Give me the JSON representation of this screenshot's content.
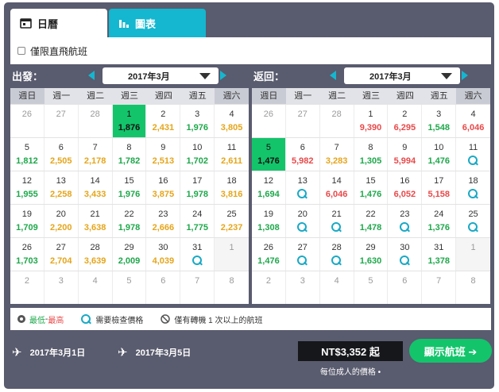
{
  "tabs": {
    "calendar": "日曆",
    "chart": "圖表"
  },
  "filter": {
    "direct_only": "僅限直飛航班"
  },
  "depart": {
    "label": "出發：",
    "month": "2017年3月",
    "dow": [
      "週日",
      "週一",
      "週二",
      "週三",
      "週四",
      "週五",
      "週六"
    ],
    "weeks": [
      [
        {
          "d": "26",
          "o": true
        },
        {
          "d": "27",
          "o": true
        },
        {
          "d": "28",
          "o": true
        },
        {
          "d": "1",
          "p": "1,876",
          "c": "low",
          "sel": true
        },
        {
          "d": "2",
          "p": "2,431",
          "c": "mid"
        },
        {
          "d": "3",
          "p": "1,976",
          "c": "low"
        },
        {
          "d": "4",
          "p": "3,805",
          "c": "mid"
        }
      ],
      [
        {
          "d": "5",
          "p": "1,812",
          "c": "low"
        },
        {
          "d": "6",
          "p": "2,505",
          "c": "mid"
        },
        {
          "d": "7",
          "p": "2,178",
          "c": "mid"
        },
        {
          "d": "8",
          "p": "1,782",
          "c": "low"
        },
        {
          "d": "9",
          "p": "2,513",
          "c": "mid"
        },
        {
          "d": "10",
          "p": "1,702",
          "c": "low"
        },
        {
          "d": "11",
          "p": "2,611",
          "c": "mid"
        }
      ],
      [
        {
          "d": "12",
          "p": "1,955",
          "c": "low"
        },
        {
          "d": "13",
          "p": "2,258",
          "c": "mid"
        },
        {
          "d": "14",
          "p": "3,433",
          "c": "mid"
        },
        {
          "d": "15",
          "p": "1,976",
          "c": "low"
        },
        {
          "d": "16",
          "p": "3,875",
          "c": "mid"
        },
        {
          "d": "17",
          "p": "1,978",
          "c": "low"
        },
        {
          "d": "18",
          "p": "3,816",
          "c": "mid"
        }
      ],
      [
        {
          "d": "19",
          "p": "1,709",
          "c": "low"
        },
        {
          "d": "20",
          "p": "2,200",
          "c": "mid"
        },
        {
          "d": "21",
          "p": "3,638",
          "c": "mid"
        },
        {
          "d": "22",
          "p": "1,978",
          "c": "low"
        },
        {
          "d": "23",
          "p": "2,666",
          "c": "mid"
        },
        {
          "d": "24",
          "p": "1,775",
          "c": "low"
        },
        {
          "d": "25",
          "p": "2,237",
          "c": "mid"
        }
      ],
      [
        {
          "d": "26",
          "p": "1,703",
          "c": "low"
        },
        {
          "d": "27",
          "p": "2,704",
          "c": "mid"
        },
        {
          "d": "28",
          "p": "3,639",
          "c": "mid"
        },
        {
          "d": "29",
          "p": "2,009",
          "c": "low"
        },
        {
          "d": "30",
          "p": "4,039",
          "c": "mid"
        },
        {
          "d": "31",
          "s": true
        },
        {
          "d": "1",
          "o": true,
          "dim": true
        }
      ],
      [
        {
          "d": "2",
          "o": true
        },
        {
          "d": "3",
          "o": true
        },
        {
          "d": "4",
          "o": true
        },
        {
          "d": "5",
          "o": true
        },
        {
          "d": "6",
          "o": true
        },
        {
          "d": "7",
          "o": true
        },
        {
          "d": "8",
          "o": true
        }
      ]
    ]
  },
  "return": {
    "label": "返回：",
    "month": "2017年3月",
    "dow": [
      "週日",
      "週一",
      "週二",
      "週三",
      "週四",
      "週五",
      "週六"
    ],
    "weeks": [
      [
        {
          "d": "26",
          "o": true
        },
        {
          "d": "27",
          "o": true
        },
        {
          "d": "28",
          "o": true
        },
        {
          "d": "1",
          "p": "9,390",
          "c": "high"
        },
        {
          "d": "2",
          "p": "6,295",
          "c": "high"
        },
        {
          "d": "3",
          "p": "1,548",
          "c": "low"
        },
        {
          "d": "4",
          "p": "6,046",
          "c": "high"
        }
      ],
      [
        {
          "d": "5",
          "p": "1,476",
          "c": "low",
          "sel": true
        },
        {
          "d": "6",
          "p": "5,982",
          "c": "high"
        },
        {
          "d": "7",
          "p": "3,283",
          "c": "mid"
        },
        {
          "d": "8",
          "p": "1,305",
          "c": "low"
        },
        {
          "d": "9",
          "p": "5,994",
          "c": "high"
        },
        {
          "d": "10",
          "p": "1,476",
          "c": "low"
        },
        {
          "d": "11",
          "s": true
        }
      ],
      [
        {
          "d": "12",
          "p": "1,694",
          "c": "low"
        },
        {
          "d": "13",
          "s": true
        },
        {
          "d": "14",
          "p": "6,046",
          "c": "high"
        },
        {
          "d": "15",
          "p": "1,476",
          "c": "low"
        },
        {
          "d": "16",
          "p": "6,052",
          "c": "high"
        },
        {
          "d": "17",
          "p": "5,158",
          "c": "high"
        },
        {
          "d": "18",
          "s": true
        }
      ],
      [
        {
          "d": "19",
          "p": "1,308",
          "c": "low"
        },
        {
          "d": "20",
          "s": true
        },
        {
          "d": "21",
          "s": true
        },
        {
          "d": "22",
          "p": "1,478",
          "c": "low"
        },
        {
          "d": "23",
          "s": true
        },
        {
          "d": "24",
          "p": "1,376",
          "c": "low"
        },
        {
          "d": "25",
          "s": true
        }
      ],
      [
        {
          "d": "26",
          "p": "1,476",
          "c": "low"
        },
        {
          "d": "27",
          "s": true
        },
        {
          "d": "28",
          "s": true
        },
        {
          "d": "29",
          "p": "1,630",
          "c": "low"
        },
        {
          "d": "30",
          "s": true
        },
        {
          "d": "31",
          "p": "1,378",
          "c": "low"
        },
        {
          "d": "1",
          "o": true,
          "dim": true
        }
      ],
      [
        {
          "d": "2",
          "o": true
        },
        {
          "d": "3",
          "o": true
        },
        {
          "d": "4",
          "o": true
        },
        {
          "d": "5",
          "o": true
        },
        {
          "d": "6",
          "o": true
        },
        {
          "d": "7",
          "o": true
        },
        {
          "d": "8",
          "o": true
        }
      ]
    ]
  },
  "legend": {
    "lowest": "最低",
    "dash": " - ",
    "highest": "最高",
    "check": "需要檢查價格",
    "transfer": "僅有轉機 1 次以上的航班"
  },
  "footer": {
    "depart_date": "2017年3月1日",
    "return_date": "2017年3月5日",
    "price": "NT$3,352 起",
    "note": "每位成人的價格 •",
    "show_button": "顯示航班 ➔"
  },
  "colors": {
    "low": "#1da84a",
    "mid": "#e5a51b",
    "high": "#e8494a",
    "selected": "#13c46b",
    "accent": "#14b7cf"
  }
}
